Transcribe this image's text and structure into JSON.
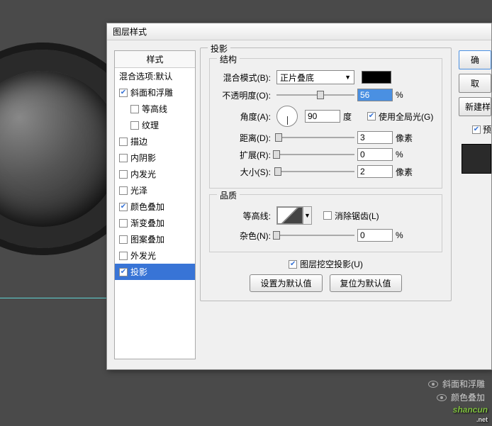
{
  "dialog": {
    "title": "图层样式"
  },
  "styleList": {
    "header": "样式",
    "blendOptions": "混合选项:默认",
    "items": [
      {
        "label": "斜面和浮雕",
        "checked": true,
        "indent": false
      },
      {
        "label": "等高线",
        "checked": false,
        "indent": true
      },
      {
        "label": "纹理",
        "checked": false,
        "indent": true
      },
      {
        "label": "描边",
        "checked": false,
        "indent": false
      },
      {
        "label": "内阴影",
        "checked": false,
        "indent": false
      },
      {
        "label": "内发光",
        "checked": false,
        "indent": false
      },
      {
        "label": "光泽",
        "checked": false,
        "indent": false
      },
      {
        "label": "颜色叠加",
        "checked": true,
        "indent": false
      },
      {
        "label": "渐变叠加",
        "checked": false,
        "indent": false
      },
      {
        "label": "图案叠加",
        "checked": false,
        "indent": false
      },
      {
        "label": "外发光",
        "checked": false,
        "indent": false
      },
      {
        "label": "投影",
        "checked": true,
        "indent": false,
        "selected": true
      }
    ]
  },
  "panel": {
    "title": "投影",
    "structure": {
      "legend": "结构",
      "blendModeLabel": "混合模式(B):",
      "blendModeValue": "正片叠底",
      "opacityLabel": "不透明度(O):",
      "opacityValue": "56",
      "opacityUnit": "%",
      "angleLabel": "角度(A):",
      "angleValue": "90",
      "angleUnit": "度",
      "globalLightLabel": "使用全局光(G)",
      "globalLightChecked": true,
      "distanceLabel": "距离(D):",
      "distanceValue": "3",
      "distanceUnit": "像素",
      "spreadLabel": "扩展(R):",
      "spreadValue": "0",
      "spreadUnit": "%",
      "sizeLabel": "大小(S):",
      "sizeValue": "2",
      "sizeUnit": "像素"
    },
    "quality": {
      "legend": "品质",
      "contourLabel": "等高线:",
      "antiAliasLabel": "消除锯齿(L)",
      "antiAliasChecked": false,
      "noiseLabel": "杂色(N):",
      "noiseValue": "0",
      "noiseUnit": "%"
    },
    "knockoutLabel": "图层挖空投影(U)",
    "knockoutChecked": true,
    "setDefaultBtn": "设置为默认值",
    "resetDefaultBtn": "复位为默认值"
  },
  "sideButtons": {
    "ok": "确",
    "cancel": "取",
    "newStyle": "新建样",
    "previewLabel": "预"
  },
  "fxLayers": {
    "items": [
      {
        "label": "斜面和浮雕"
      },
      {
        "label": "颜色叠加"
      }
    ]
  },
  "watermark": {
    "main": "shancun",
    "sub": ".net"
  }
}
